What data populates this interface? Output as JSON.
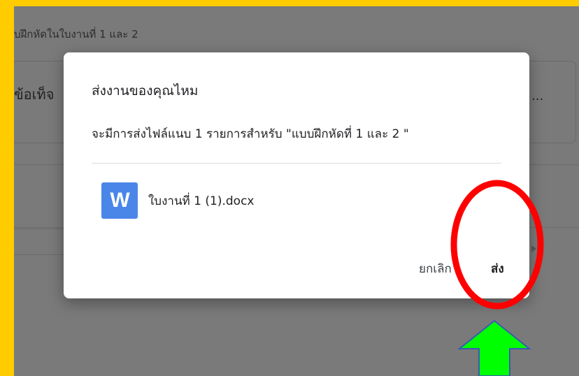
{
  "background": {
    "assignment_text": "บฝึกหัดในใบงานที่ 1 และ 2",
    "card_title": "ข้อเท็จ",
    "card_ellipsis": "..."
  },
  "dialog": {
    "title": "ส่งงานของคุณไหม",
    "message": "จะมีการส่งไฟล์แนบ 1 รายการสำหรับ \"แบบฝึกหัดที่ 1 และ 2 \"",
    "attachment": {
      "icon_letter": "W",
      "file_name": "ใบงานที่ 1 (1).docx"
    },
    "cancel_label": "ยกเลิก",
    "submit_label": "ส่ง"
  },
  "colors": {
    "frame_border": "#ffcc00",
    "overlay": "#7a7a7a",
    "word_icon": "#4a86e8",
    "annotation_circle": "#ff0000",
    "annotation_arrow": "#00ff00"
  },
  "icons": {
    "attachment": "word-doc-icon",
    "annotation_arrow": "up-arrow-icon"
  }
}
